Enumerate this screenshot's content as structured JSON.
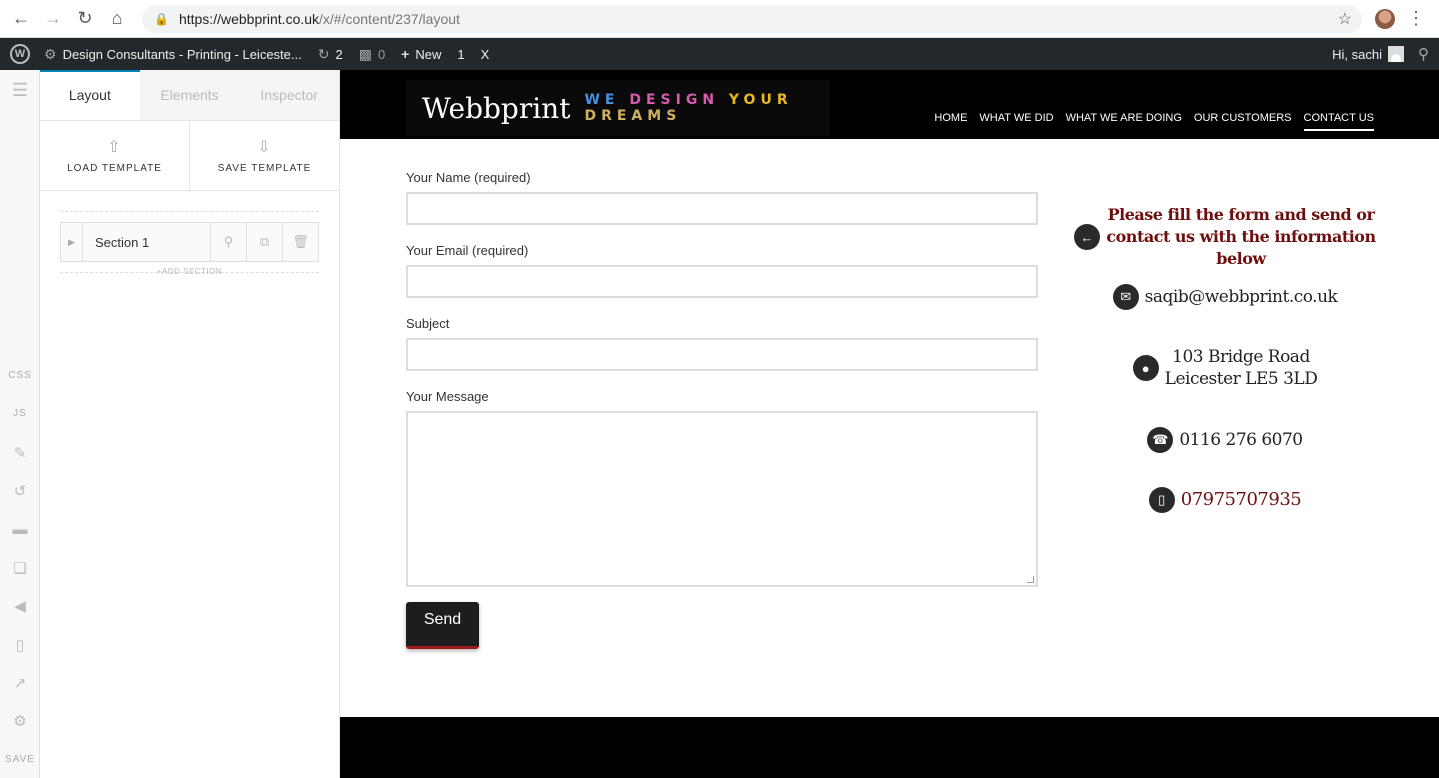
{
  "browser": {
    "url_host": "https://webbprint.co.uk",
    "url_path": "/x/#/content/237/layout"
  },
  "wp_admin_bar": {
    "site_title": "Design Consultants - Printing - Leiceste...",
    "updates_count": "2",
    "comments_count": "0",
    "new_label": "New",
    "extra_1": "1",
    "extra_2": "X",
    "greeting": "Hi, sachi"
  },
  "builder_rail": {
    "css_label": "CSS",
    "js_label": "JS",
    "save_label": "SAVE"
  },
  "builder_panel": {
    "tabs": [
      {
        "label": "Layout",
        "active": true
      },
      {
        "label": "Elements",
        "active": false
      },
      {
        "label": "Inspector",
        "active": false
      }
    ],
    "load_template": "LOAD TEMPLATE",
    "save_template": "SAVE TEMPLATE",
    "section_name": "Section 1",
    "add_section": "+ADD SECTION"
  },
  "site": {
    "logo_text": "Webbprint",
    "tagline": [
      "WE",
      "DESIGN",
      "YOUR",
      "DREAMS"
    ],
    "menu": [
      {
        "label": "HOME",
        "current": false
      },
      {
        "label": "WHAT WE DID",
        "current": false
      },
      {
        "label": "WHAT WE ARE DOING",
        "current": false
      },
      {
        "label": "OUR CUSTOMERS",
        "current": false
      },
      {
        "label": "CONTACT US",
        "current": true
      }
    ],
    "form": {
      "name_label": "Your Name (required)",
      "email_label": "Your Email (required)",
      "subject_label": "Subject",
      "message_label": "Your Message",
      "send_label": "Send"
    },
    "contact": {
      "intro": "Please fill the form and send or contact us with the information below",
      "email": "saqib@webbprint.co.uk",
      "address_line1": "103 Bridge Road",
      "address_line2": "Leicester LE5 3LD",
      "phone": "0116 276 6070",
      "mobile": "07975707935"
    }
  },
  "icons": {
    "back": "arrow-left-icon",
    "email": "envelope-icon",
    "address": "map-pin-icon",
    "phone": "phone-icon",
    "mobile": "mobile-icon"
  },
  "colors": {
    "wp_bar": "#23282d",
    "accent_tab": "#0085ba",
    "contact_red": "#6e1010",
    "send_border": "#a11a1a"
  }
}
